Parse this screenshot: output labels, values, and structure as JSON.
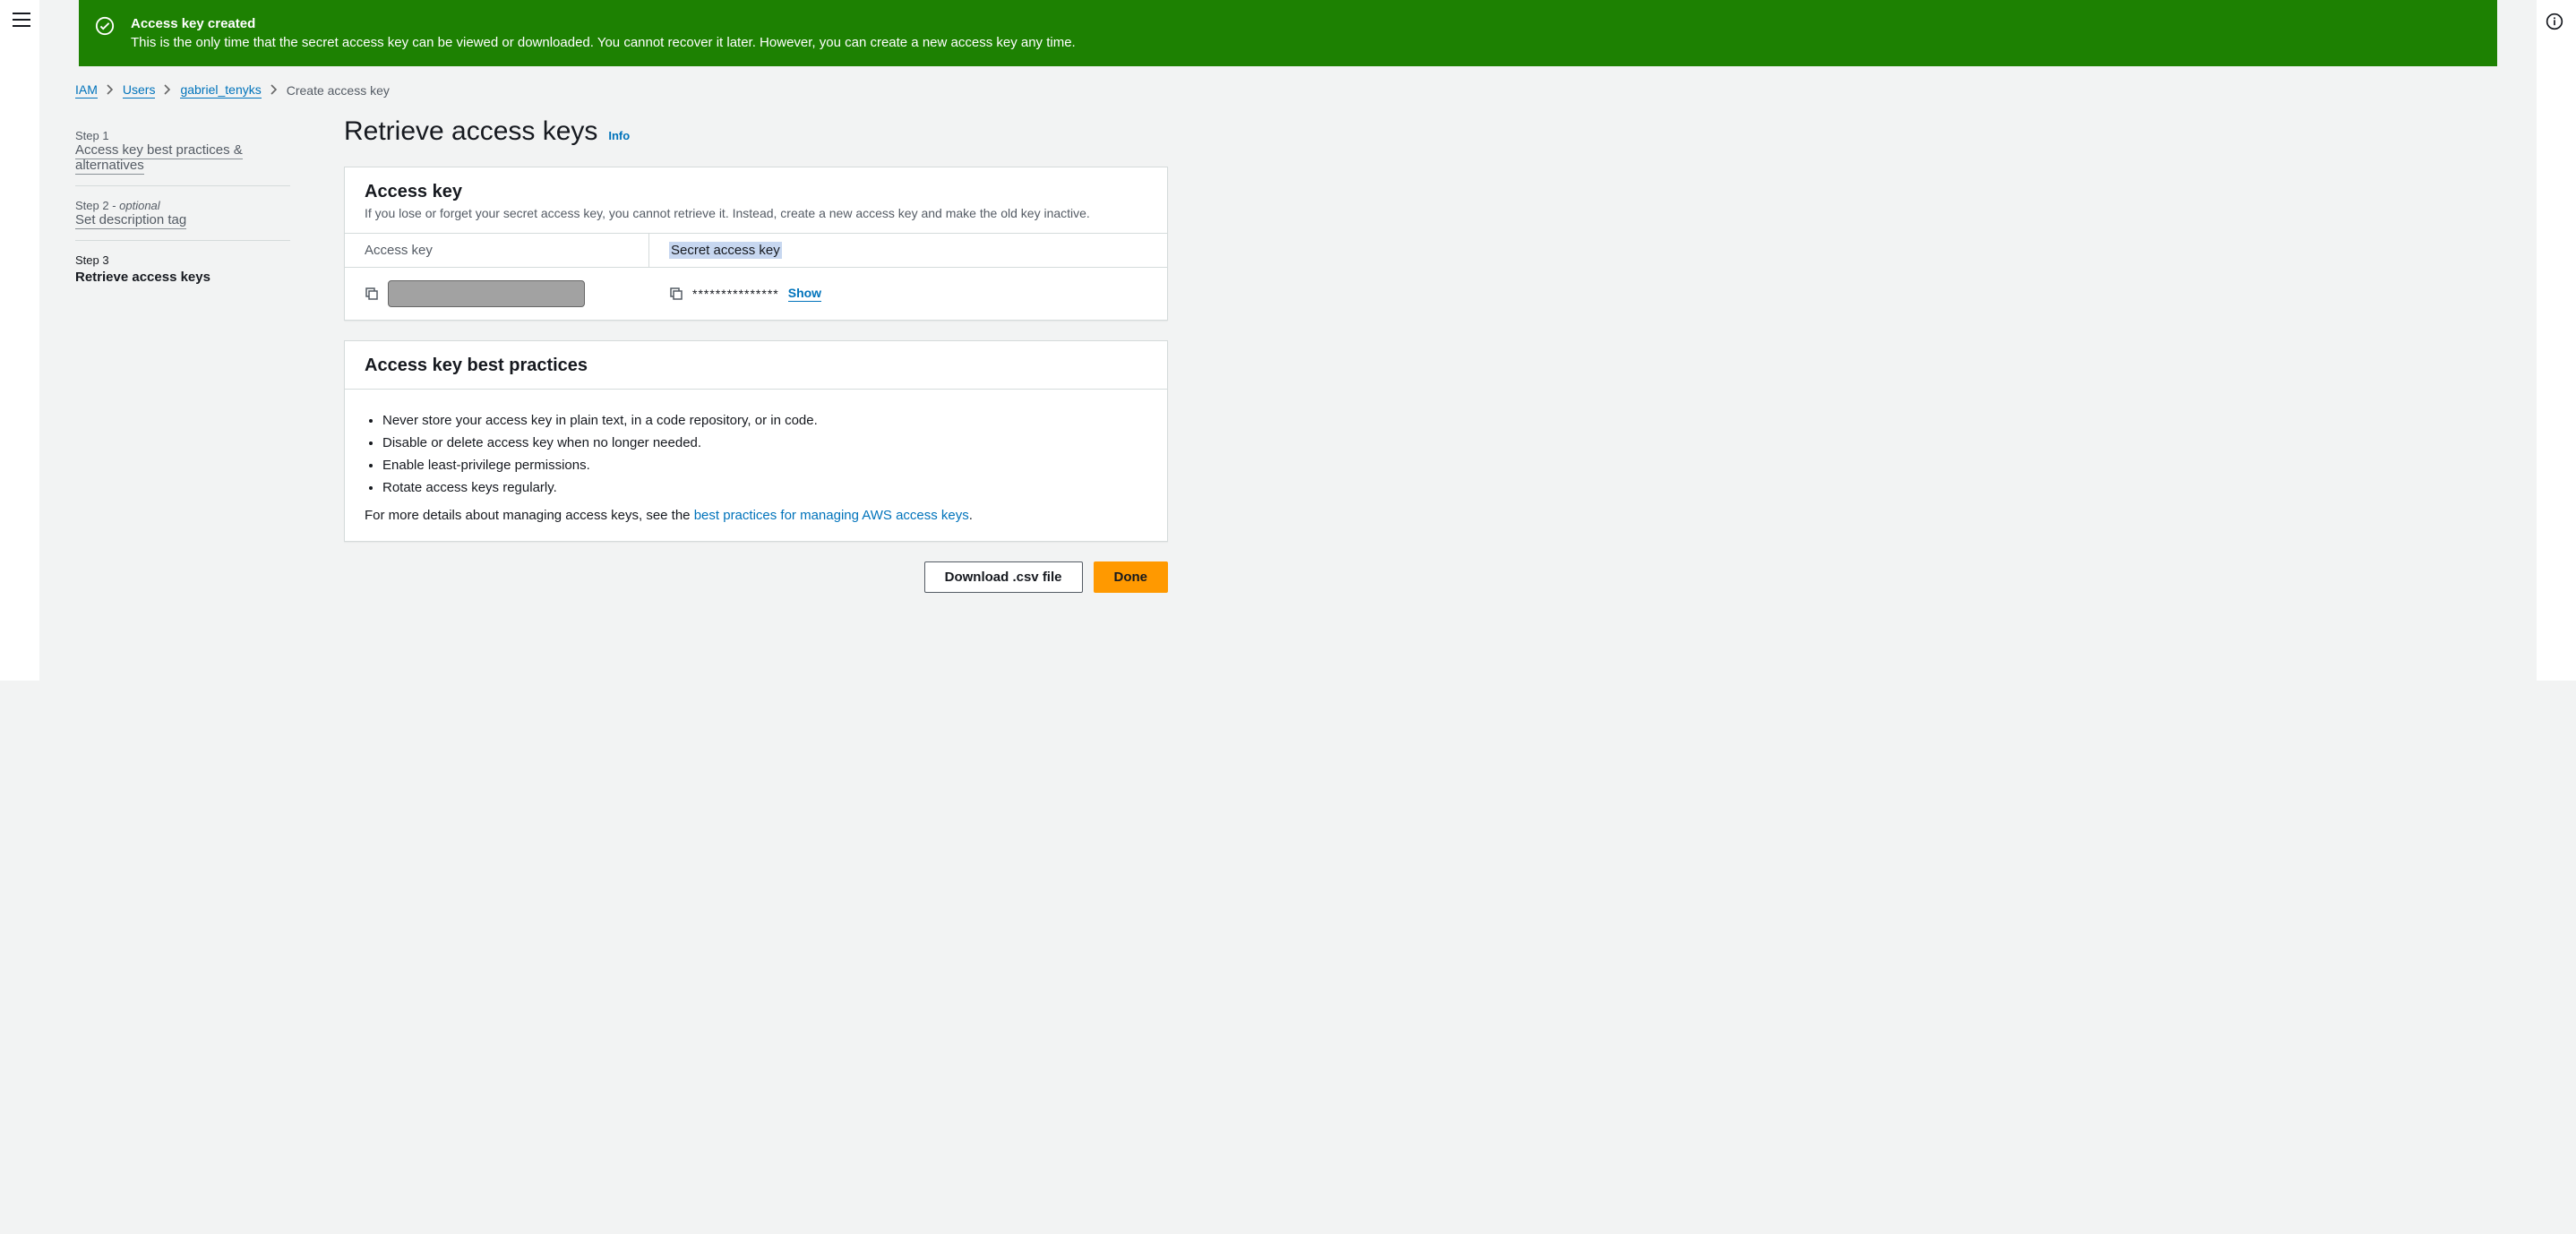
{
  "banner": {
    "title": "Access key created",
    "message": "This is the only time that the secret access key can be viewed or downloaded. You cannot recover it later. However, you can create a new access key any time."
  },
  "breadcrumb": {
    "items": [
      "IAM",
      "Users",
      "gabriel_tenyks"
    ],
    "current": "Create access key"
  },
  "steps": {
    "s1_label": "Step 1",
    "s1_name": "Access key best practices & alternatives",
    "s2_label": "Step 2 - ",
    "s2_opt": "optional",
    "s2_name": "Set description tag",
    "s3_label": "Step 3",
    "s3_name": "Retrieve access keys"
  },
  "heading": {
    "title": "Retrieve access keys",
    "info": "Info"
  },
  "access_key_card": {
    "title": "Access key",
    "desc": "If you lose or forget your secret access key, you cannot retrieve it. Instead, create a new access key and make the old key inactive.",
    "col1": "Access key",
    "col2": "Secret access key",
    "secret_masked": "***************",
    "show": "Show"
  },
  "best_practices": {
    "title": "Access key best practices",
    "items": [
      "Never store your access key in plain text, in a code repository, or in code.",
      "Disable or delete access key when no longer needed.",
      "Enable least-privilege permissions.",
      "Rotate access keys regularly."
    ],
    "more_prefix": "For more details about managing access keys, see the ",
    "more_link": "best practices for managing AWS access keys",
    "more_suffix": "."
  },
  "actions": {
    "download": "Download .csv file",
    "done": "Done"
  }
}
